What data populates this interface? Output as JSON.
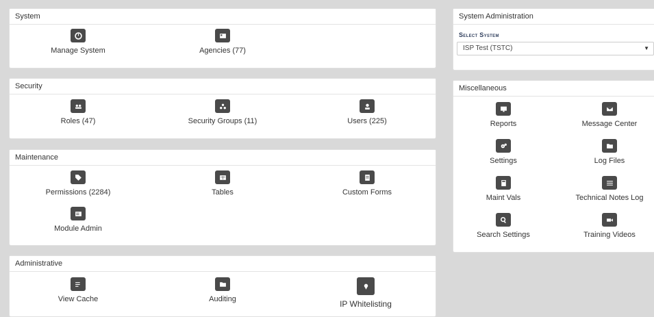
{
  "system": {
    "title": "System",
    "tiles": [
      {
        "label": "Manage System",
        "icon": "gauge-icon"
      },
      {
        "label": "Agencies (77)",
        "icon": "picture-icon"
      }
    ]
  },
  "security": {
    "title": "Security",
    "tiles": [
      {
        "label": "Roles (47)",
        "icon": "users-group-icon"
      },
      {
        "label": "Security Groups (11)",
        "icon": "sitemap-icon"
      },
      {
        "label": "Users (225)",
        "icon": "user-icon"
      }
    ]
  },
  "maintenance": {
    "title": "Maintenance",
    "tiles": [
      {
        "label": "Permissions (2284)",
        "icon": "tags-icon"
      },
      {
        "label": "Tables",
        "icon": "table-icon"
      },
      {
        "label": "Custom Forms",
        "icon": "form-icon"
      },
      {
        "label": "Module Admin",
        "icon": "module-icon"
      }
    ]
  },
  "administrative": {
    "title": "Administrative",
    "tiles": [
      {
        "label": "View Cache",
        "icon": "list-edit-icon"
      },
      {
        "label": "Auditing",
        "icon": "folder-open-icon"
      },
      {
        "label": "IP Whitelisting",
        "icon": "map-marker-icon"
      }
    ]
  },
  "sysadmin": {
    "title": "System Administration",
    "select_label": "Select System",
    "selected_value": "ISP Test (TSTC)"
  },
  "misc": {
    "title": "Miscellaneous",
    "tiles": [
      {
        "label": "Reports",
        "icon": "desktop-chart-icon"
      },
      {
        "label": "Message Center",
        "icon": "envelope-icon"
      },
      {
        "label": "Settings",
        "icon": "cogs-icon"
      },
      {
        "label": "Log Files",
        "icon": "folder-icon"
      },
      {
        "label": "Maint Vals",
        "icon": "calculator-icon"
      },
      {
        "label": "Technical Notes Log",
        "icon": "list-icon"
      },
      {
        "label": "Search Settings",
        "icon": "search-icon"
      },
      {
        "label": "Training Videos",
        "icon": "video-camera-icon"
      }
    ]
  }
}
